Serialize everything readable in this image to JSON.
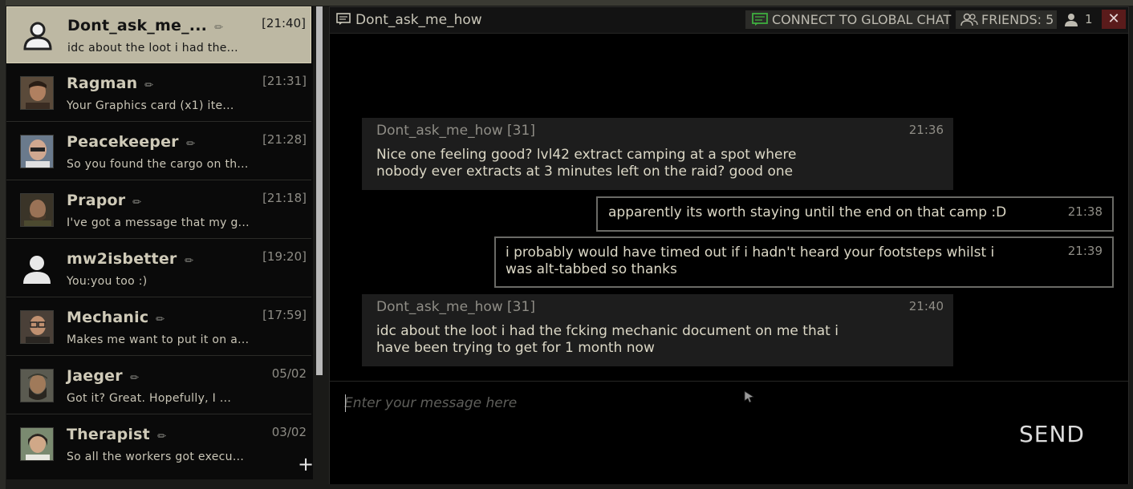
{
  "dialogs": [
    {
      "name": "Dont_ask_me_...",
      "time": "[21:40]",
      "preview": "idc about the loot i had the...",
      "avatar": "person-silhouette-icon",
      "active": true
    },
    {
      "name": "Ragman",
      "time": "[21:31]",
      "preview": "Your Graphics card  (x1) ite...",
      "avatar": "ragman-portrait"
    },
    {
      "name": "Peacekeeper",
      "time": "[21:28]",
      "preview": "So you found the cargo on th...",
      "avatar": "peacekeeper-portrait"
    },
    {
      "name": "Prapor",
      "time": "[21:18]",
      "preview": "I've got a message that my g...",
      "avatar": "prapor-portrait"
    },
    {
      "name": "mw2isbetter",
      "time": "[19:20]",
      "preview": "You:you too :)",
      "avatar": "person-silhouette-icon"
    },
    {
      "name": "Mechanic",
      "time": "[17:59]",
      "preview": "Makes me want to put it on a...",
      "avatar": "mechanic-portrait"
    },
    {
      "name": "Jaeger",
      "time": "05/02",
      "preview": "Got it? Great. Hopefully, I ...",
      "avatar": "jaeger-portrait"
    },
    {
      "name": "Therapist",
      "time": "03/02",
      "preview": "So all the workers got execu...",
      "avatar": "therapist-portrait"
    }
  ],
  "add_dialog_label": "+",
  "chat": {
    "title": "Dont_ask_me_how",
    "global_chat_label": "CONNECT TO GLOBAL CHAT",
    "friends_label": "FRIENDS: 5",
    "participants_count": "1",
    "close_label": "✕"
  },
  "messages": [
    {
      "direction": "in",
      "author": "Dont_ask_me_how [31]",
      "time": "21:36",
      "lines": [
        "Nice one feeling good? lvl42 extract camping at a spot where",
        "nobody ever extracts at 3 minutes left on the raid? good one"
      ]
    },
    {
      "direction": "out",
      "time": "21:38",
      "lines": [
        "apparently its worth staying until the end on that camp :D"
      ]
    },
    {
      "direction": "out",
      "time": "21:39",
      "lines": [
        "i probably would have timed out if i hadn't heard your footsteps whilst i",
        "was alt-tabbed so thanks"
      ]
    },
    {
      "direction": "in",
      "author": "Dont_ask_me_how [31]",
      "time": "21:40",
      "lines": [
        "idc about the loot i had the fcking mechanic document on me that i",
        "have been trying to get for 1 month now"
      ]
    }
  ],
  "input": {
    "placeholder": "Enter your message here",
    "value": ""
  },
  "send_label": "SEND",
  "colors": {
    "active_dialog": "#bdb8a3",
    "close_button": "#5a1b1b",
    "global_chat_icon": "#3fae3f"
  }
}
